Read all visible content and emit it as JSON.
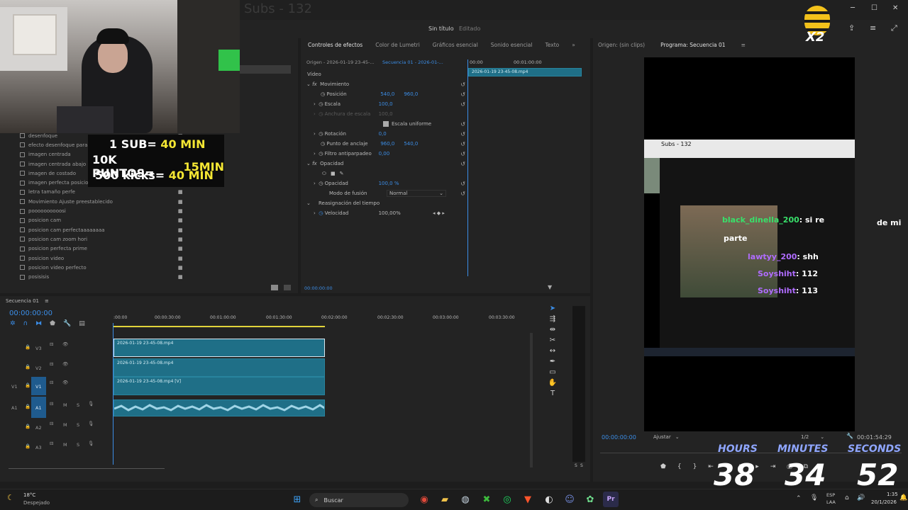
{
  "window": {
    "title": "Sin título",
    "edited": "Editado",
    "ghost_title": "Subs - 132"
  },
  "effects_panel": {
    "items": [
      "desenfoque",
      "efecto desenfoque para ve",
      "imagen centrada",
      "imagen centrada abajo pa",
      "imagen de costado",
      "imagen perfecta posicion",
      "letra tamaño perfe",
      "Movimiento Ajuste preestablecido",
      "poooooooooosi",
      "posicion cam",
      "posicion cam perfectaaaaaaaa",
      "posicion cam zoom hori",
      "posicion perfecta prime",
      "posicion video",
      "posicion video perfecto",
      "posisisis"
    ]
  },
  "effect_controls": {
    "tabs": [
      "Controles de efectos",
      "Color de Lumetri",
      "Gráficos esencial",
      "Sonido esencial",
      "Texto"
    ],
    "origin": "Origen - 2026-01-19 23-45-...",
    "sequence": "Secuencia 01 - 2026-01-...",
    "ruler": [
      "00:00",
      "00:01:00:00"
    ],
    "clip_name": "2026-01-19 23-45-08.mp4",
    "video_label": "Vídeo",
    "movement": "Movimiento",
    "position_label": "Posición",
    "position_x": "540,0",
    "position_y": "960,0",
    "scale_label": "Escala",
    "scale_value": "100,0",
    "scale_width_label": "Anchura de escala",
    "scale_width_value": "100,0",
    "uniform_scale": "Escala uniforme",
    "rotation_label": "Rotación",
    "rotation_value": "0,0",
    "anchor_label": "Punto de anclaje",
    "anchor_x": "960,0",
    "anchor_y": "540,0",
    "flicker_label": "Filtro antiparpadeo",
    "flicker_value": "0,00",
    "opacity_section": "Opacidad",
    "opacity_label": "Opacidad",
    "opacity_value": "100,0 %",
    "blend_label": "Modo de fusión",
    "blend_value": "Normal",
    "time_remap": "Reasignación del tiempo",
    "speed_label": "Velocidad",
    "speed_value": "100,00%",
    "timecode": "00:00:00:00"
  },
  "program": {
    "tab_source": "Origen: (sin clips)",
    "tab_program": "Programa: Secuencia 01",
    "timecode": "00:00:00:00",
    "fit": "Ajustar",
    "quality": "1/2",
    "duration": "00:01:54:29"
  },
  "preview": {
    "subs_bar": "Subs - 132",
    "chat": [
      {
        "user": "black_dinella_200",
        "msg": ": si re",
        "color": "#38e06a"
      },
      {
        "user": "",
        "msg": "parte",
        "color": "#ffffff"
      },
      {
        "user": "lawtyy_200",
        "msg": ": shh",
        "color": "#b06cff"
      },
      {
        "user": "Soyshiht",
        "msg": ": 112",
        "color": "#b06cff"
      },
      {
        "user": "Soyshiht",
        "msg": ": 113",
        "color": "#b06cff"
      }
    ],
    "chat_right_text": "de mi"
  },
  "timeline": {
    "title": "Secuencia 01",
    "timecode": "00:00:00:00",
    "ruler": [
      ":00:00",
      "00:00:30:00",
      "00:01:00:00",
      "00:01:30:00",
      "00:02:00:00",
      "00:02:30:00",
      "00:03:00:00",
      "00:03:30:00"
    ],
    "video_tracks": [
      {
        "name": "V3",
        "clip": "2026-01-19 23-45-08.mp4"
      },
      {
        "name": "V2",
        "clip": "2026-01-19 23-45-08.mp4"
      },
      {
        "name": "V1",
        "clip": "2026-01-19 23-45-08.mp4 [V]"
      }
    ],
    "audio_tracks": [
      "A1",
      "A2",
      "A3"
    ],
    "track_buttons": [
      "M",
      "S"
    ],
    "meter": [
      "S",
      "S"
    ]
  },
  "stream_overlay": {
    "goals": [
      {
        "label": "1 SUB=",
        "value": "40 MIN"
      },
      {
        "label": "10K PUNTOS=",
        "value": "15MIN"
      },
      {
        "label": "500 kicks=",
        "value": "40 MIN"
      }
    ],
    "timer_labels": [
      "HOURS",
      "MINUTES",
      "SECONDS"
    ],
    "timer_values": [
      "38",
      "34",
      "52"
    ],
    "mult_badge": "X2"
  },
  "taskbar": {
    "weather_temp": "18°C",
    "weather_desc": "Despejado",
    "search_placeholder": "Buscar",
    "lang1": "ESP",
    "lang2": "LAA",
    "time": "1:35",
    "date": "20/1/2026"
  }
}
